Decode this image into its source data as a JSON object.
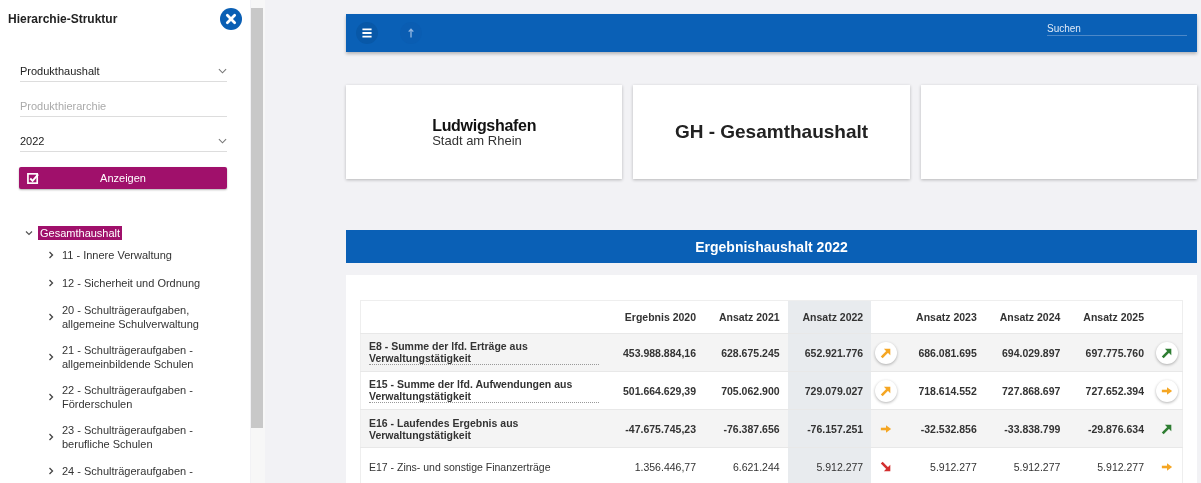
{
  "sidebar": {
    "title": "Hierarchie-Struktur",
    "fields": [
      {
        "kind": "select",
        "value": "Produkthaushalt"
      },
      {
        "kind": "input",
        "placeholder": "Produkthierarchie"
      },
      {
        "kind": "select",
        "value": "2022"
      }
    ],
    "button": "Anzeigen",
    "tree": {
      "label": "Gesamthaushalt",
      "expanded": true,
      "selected": true,
      "children": [
        {
          "label": "11 - Innere Verwaltung",
          "expanded": false
        },
        {
          "label": "12 - Sicherheit und Ordnung",
          "expanded": false
        },
        {
          "label": "20 - Schulträgeraufgaben, allgemeine Schulverwaltung",
          "expanded": false
        },
        {
          "label": "21 - Schulträgeraufgaben - allgemeinbildende Schulen",
          "expanded": false
        },
        {
          "label": "22 - Schulträgeraufgaben - Förderschulen",
          "expanded": false
        },
        {
          "label": "23 - Schulträgeraufgaben - berufliche Schulen",
          "expanded": false
        },
        {
          "label": "24 - Schulträgeraufgaben -",
          "expanded": false
        }
      ]
    }
  },
  "toolbar": {
    "search": {
      "placeholder": "Suchen"
    }
  },
  "cards": {
    "logo": {
      "name": "Ludwigshafen",
      "subtitle": "Stadt am Rhein"
    },
    "title": "GH - Gesamthaushalt"
  },
  "section": {
    "title": "Ergebnishaushalt 2022"
  },
  "table": {
    "columns": [
      {
        "label": "Ergebnis 2020",
        "highlighted": false
      },
      {
        "label": "Ansatz 2021",
        "highlighted": false
      },
      {
        "label": "Ansatz 2022",
        "highlighted": true
      },
      {
        "label": "Ansatz 2023",
        "highlighted": false
      },
      {
        "label": "Ansatz 2024",
        "highlighted": false
      },
      {
        "label": "Ansatz 2025",
        "highlighted": false
      }
    ],
    "rows": [
      {
        "label": "E8 - Summe der lfd. Erträge aus Verwaltungstätigkeit",
        "kind": "sum",
        "linked": true,
        "values": [
          "453.988.884,16",
          "628.675.245",
          "652.921.776",
          "686.081.695",
          "694.029.897",
          "697.775.760"
        ],
        "trends": [
          {
            "kind": "up",
            "color": "#f5a623",
            "circled": true
          },
          {
            "kind": "up",
            "color": "#2e7d32",
            "circled": true
          }
        ]
      },
      {
        "label": "E15 - Summe der lfd. Aufwendungen aus Verwaltungstätigkeit",
        "kind": "sum",
        "linked": true,
        "values": [
          "501.664.629,39",
          "705.062.900",
          "729.079.027",
          "718.614.552",
          "727.868.697",
          "727.652.394"
        ],
        "trends": [
          {
            "kind": "up",
            "color": "#f5a623",
            "circled": true
          },
          {
            "kind": "flat",
            "color": "#f5a623",
            "circled": true
          }
        ]
      },
      {
        "label": "E16 - Laufendes Ergebnis aus Verwaltungstätigkeit",
        "kind": "sum",
        "linked": false,
        "values": [
          "-47.675.745,23",
          "-76.387.656",
          "-76.157.251",
          "-32.532.856",
          "-33.838.799",
          "-29.876.634"
        ],
        "trends": [
          {
            "kind": "flat",
            "color": "#f5a623",
            "circled": false
          },
          {
            "kind": "up",
            "color": "#2e7d32",
            "circled": false
          }
        ]
      },
      {
        "label": "E17 - Zins- und sonstige Finanzerträge",
        "kind": "item",
        "linked": false,
        "values": [
          "1.356.446,77",
          "6.621.244",
          "5.912.277",
          "5.912.277",
          "5.912.277",
          "5.912.277"
        ],
        "trends": [
          {
            "kind": "down",
            "color": "#d32f2f",
            "circled": false
          },
          {
            "kind": "flat",
            "color": "#f5a623",
            "circled": false
          }
        ]
      }
    ]
  }
}
